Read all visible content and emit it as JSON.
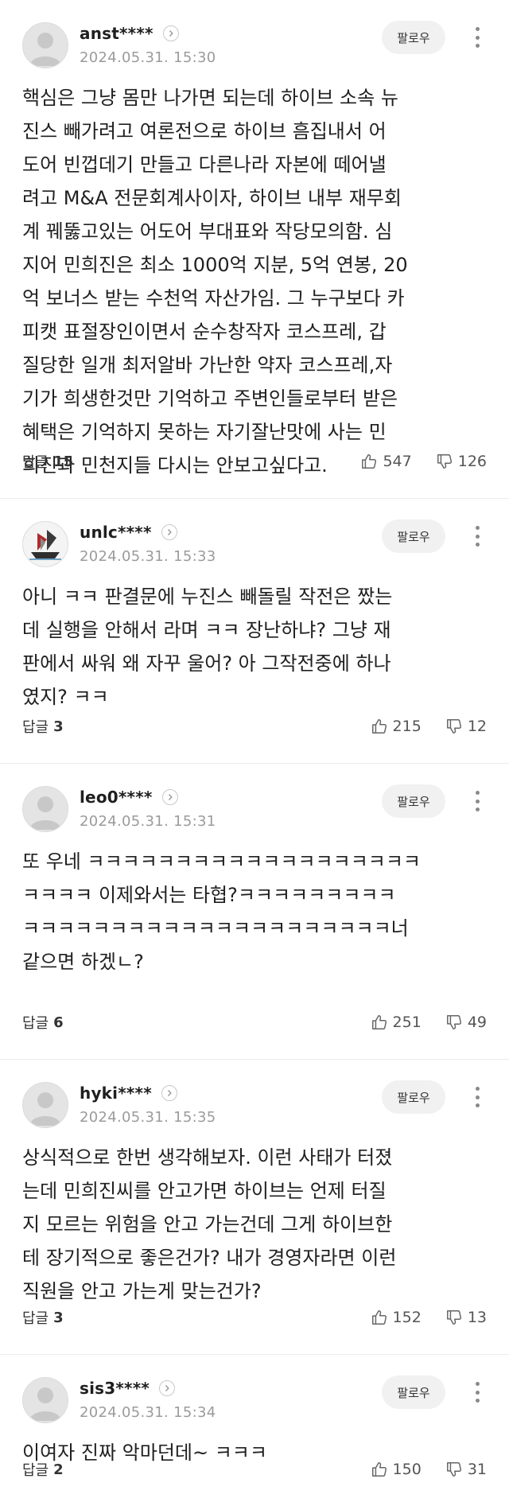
{
  "follow_label": "팔로우",
  "reply_label": "답글",
  "comments": [
    {
      "nickname": "anst****",
      "date": "2024.05.31. 15:30",
      "lines": [
        "핵심은 그냥 몸만 나가면 되는데 하이브 소속 뉴",
        "진스 빼가려고 여론전으로 하이브 흠집내서 어",
        "도어 빈껍데기 만들고 다른나라 자본에 떼어낼",
        "려고 M&A 전문회계사이자, 하이브 내부 재무회",
        "계 꿰뚫고있는 어도어 부대표와 작당모의함. 심",
        "지어 민희진은 최소 1000억 지분, 5억 연봉, 20",
        "억 보너스 받는 수천억 자산가임. 그 누구보다 카",
        "피캣 표절장인이면서 순수창작자 코스프레, 갑",
        "질당한 일개 최저알바 가난한 약자 코스프레,자",
        "기가 희생한것만 기억하고 주변인들로부터 받은",
        "혜택은 기억하지 못하는 자기잘난맛에 사는 민",
        "희진과 민천지들 다시는 안보고싶다고."
      ],
      "reply_count": "15",
      "likes": "547",
      "dislikes": "126"
    },
    {
      "nickname": "unlc****",
      "date": "2024.05.31. 15:33",
      "lines": [
        "아니 ㅋㅋ 판결문에 누진스 빼돌릴 작전은 짰는",
        "데 실행을 안해서 라며 ㅋㅋ 장난하냐? 그냥 재",
        "판에서 싸워 왜 자꾸 울어? 아 그작전중에 하나",
        "였지? ㅋㅋ"
      ],
      "reply_count": "3",
      "likes": "215",
      "dislikes": "12"
    },
    {
      "nickname": "leo0****",
      "date": "2024.05.31. 15:31",
      "lines": [
        "또 우네 ㅋㅋㅋㅋㅋㅋㅋㅋㅋㅋㅋㅋㅋㅋㅋㅋㅋㅋㅋ",
        "ㅋㅋㅋㅋ 이제와서는 타협?ㅋㅋㅋㅋㅋㅋㅋㅋㅋ",
        "ㅋㅋㅋㅋㅋㅋㅋㅋㅋㅋㅋㅋㅋㅋㅋㅋㅋㅋㅋㅋㅋ너",
        "같으면 하겠ㄴ?"
      ],
      "reply_count": "6",
      "likes": "251",
      "dislikes": "49"
    },
    {
      "nickname": "hyki****",
      "date": "2024.05.31. 15:35",
      "lines": [
        "상식적으로 한번 생각해보자. 이런 사태가 터졌",
        "는데 민희진씨를 안고가면 하이브는 언제 터질",
        "지 모르는 위험을 안고 가는건데 그게 하이브한",
        "테 장기적으로 좋은건가? 내가 경영자라면 이런",
        "직원을 안고 가는게 맞는건가?"
      ],
      "reply_count": "3",
      "likes": "152",
      "dislikes": "13"
    },
    {
      "nickname": "sis3****",
      "date": "2024.05.31. 15:34",
      "lines": [
        "이여자 진짜 악마던데~ ㅋㅋㅋ"
      ],
      "reply_count": "2",
      "likes": "150",
      "dislikes": "31"
    }
  ]
}
